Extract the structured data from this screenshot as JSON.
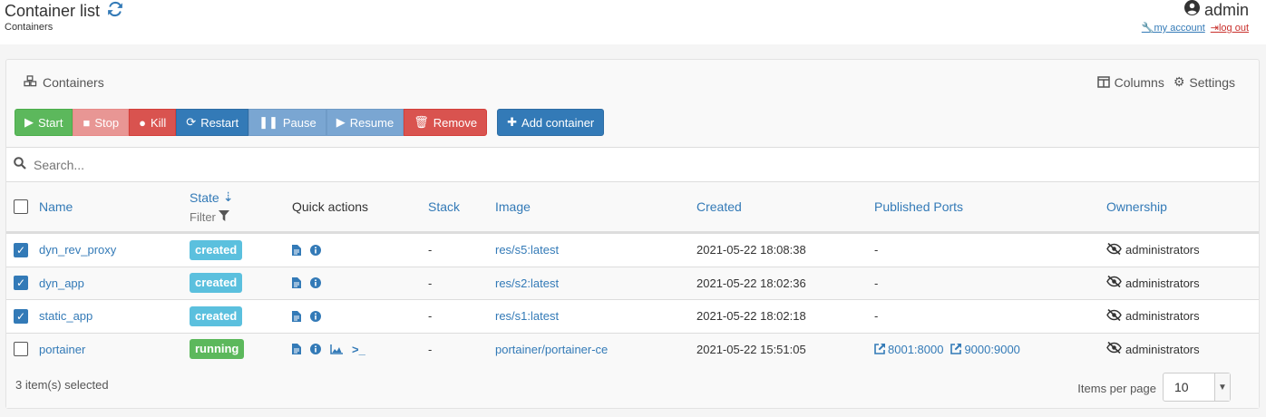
{
  "header": {
    "title": "Container list",
    "breadcrumb": "Containers",
    "username": "admin",
    "my_account": "my account",
    "log_out": "log out"
  },
  "panel": {
    "title": "Containers",
    "columns_label": "Columns",
    "settings_label": "Settings"
  },
  "actions": {
    "start": "Start",
    "stop": "Stop",
    "kill": "Kill",
    "restart": "Restart",
    "pause": "Pause",
    "resume": "Resume",
    "remove": "Remove",
    "add": "Add container"
  },
  "search": {
    "placeholder": "Search..."
  },
  "columns": {
    "name": "Name",
    "state": "State",
    "filter": "Filter",
    "quick_actions": "Quick actions",
    "stack": "Stack",
    "image": "Image",
    "created": "Created",
    "ports": "Published Ports",
    "ownership": "Ownership"
  },
  "rows": [
    {
      "checked": true,
      "name": "dyn_rev_proxy",
      "state": "created",
      "state_color": "#5bc0de",
      "stack": "-",
      "image": "res/s5:latest",
      "created": "2021-05-22 18:08:38",
      "ports": "-",
      "ownership": "administrators"
    },
    {
      "checked": true,
      "name": "dyn_app",
      "state": "created",
      "state_color": "#5bc0de",
      "stack": "-",
      "image": "res/s2:latest",
      "created": "2021-05-22 18:02:36",
      "ports": "-",
      "ownership": "administrators"
    },
    {
      "checked": true,
      "name": "static_app",
      "state": "created",
      "state_color": "#5bc0de",
      "stack": "-",
      "image": "res/s1:latest",
      "created": "2021-05-22 18:02:18",
      "ports": "-",
      "ownership": "administrators"
    },
    {
      "checked": false,
      "name": "portainer",
      "state": "running",
      "state_color": "#5cb85c",
      "stack": "-",
      "image": "portainer/portainer-ce",
      "created": "2021-05-22 15:51:05",
      "port_links": [
        "8001:8000",
        "9000:9000"
      ],
      "ownership": "administrators"
    }
  ],
  "footer": {
    "selected": "3 item(s) selected",
    "items_per_page_label": "Items per page",
    "items_per_page": "10"
  },
  "colors": {
    "primary": "#337ab7",
    "success": "#5cb85c",
    "danger": "#d9534f",
    "info": "#5bc0de"
  }
}
